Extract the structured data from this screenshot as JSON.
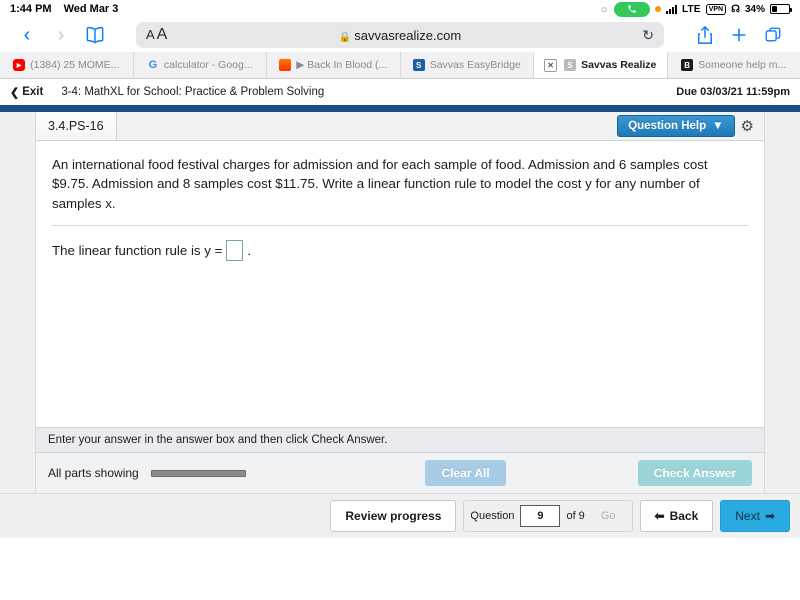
{
  "status_bar": {
    "time": "1:44 PM",
    "date": "Wed Mar 3",
    "location_icon": "location-arrow-icon",
    "call_icon": "phone-call-icon",
    "recording_dot": "orange-privacy-dot",
    "signal_icon": "cellular-signal-icon",
    "network": "LTE",
    "vpn": "VPN",
    "headset_icon": "headphones-icon",
    "battery_pct": "34%",
    "battery_icon": "battery-icon"
  },
  "browser": {
    "back_icon": "chevron-left-icon",
    "forward_icon": "chevron-right-icon",
    "bookmarks_icon": "book-icon",
    "text_size_label": "AA",
    "lock_icon": "lock-icon",
    "url": "savvasrealize.com",
    "reload_icon": "reload-icon",
    "share_icon": "share-icon",
    "new_tab_icon": "plus-icon",
    "tabs_overview_icon": "tabs-icon",
    "tabs": [
      {
        "label": "(1384) 25 MOME...",
        "favicon": "youtube-icon",
        "active": false
      },
      {
        "label": "calculator - Goog...",
        "favicon": "google-icon",
        "active": false
      },
      {
        "label": "▶ Back In Blood (...",
        "favicon": "soundcloud-icon",
        "active": false
      },
      {
        "label": "Savvas EasyBridge",
        "favicon": "easybridge-icon",
        "active": false
      },
      {
        "label": "Savvas Realize",
        "favicon": "savvas-realize-icon",
        "active": true,
        "close_icon": "close-icon"
      },
      {
        "label": "Someone help m...",
        "favicon": "brainly-icon",
        "active": false
      }
    ]
  },
  "assignment": {
    "exit_label": "Exit",
    "exit_icon": "chevron-left-icon",
    "title": "3-4: MathXL for School: Practice & Problem Solving",
    "due": "Due 03/03/21 11:59pm"
  },
  "question": {
    "id": "3.4.PS-16",
    "help_label": "Question Help",
    "help_caret": "▼",
    "settings_icon": "gear-icon",
    "text": "An international food festival charges for admission and for each sample of food. Admission and 6 samples cost $9.75. Admission and 8 samples cost $11.75. Write a linear function rule to model the cost y for any number of samples x.",
    "answer_prefix": "The linear function rule is y =",
    "answer_suffix": ".",
    "answer_value": ""
  },
  "footer": {
    "hint": "Enter your answer in the answer box and then click Check Answer.",
    "parts_label": "All parts showing",
    "progress_pct": 100,
    "clear_all_label": "Clear All",
    "check_answer_label": "Check Answer"
  },
  "bottom_nav": {
    "review_label": "Review progress",
    "question_label": "Question",
    "question_number": "9",
    "of_label": "of 9",
    "go_label": "Go",
    "back_label": "Back",
    "back_icon": "arrow-left-icon",
    "next_label": "Next",
    "next_icon": "arrow-right-icon"
  },
  "colors": {
    "accent_blue": "#1b4f82",
    "next_blue": "#29abe2",
    "help_blue": "#2f8ec9",
    "check_teal": "#9bd5da",
    "clear_blue": "#a8cbe6"
  }
}
